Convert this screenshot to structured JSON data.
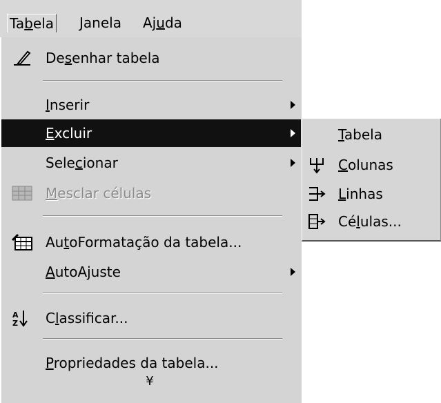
{
  "menubar": {
    "items": [
      {
        "pre": "Ta",
        "key": "b",
        "post": "ela"
      },
      {
        "pre": "",
        "key": "J",
        "post": "anela"
      },
      {
        "pre": "Aj",
        "key": "u",
        "post": "da"
      }
    ]
  },
  "menu": {
    "items": [
      {
        "pre": "De",
        "key": "s",
        "post": "enhar tabela",
        "icon": "pencil-icon"
      },
      {
        "pre": "",
        "key": "I",
        "post": "nserir",
        "submenu": true
      },
      {
        "pre": "",
        "key": "E",
        "post": "xcluir",
        "submenu": true,
        "highlighted": true
      },
      {
        "pre": "Sele",
        "key": "c",
        "post": "ionar",
        "submenu": true
      },
      {
        "pre": "",
        "key": "M",
        "post": "esclar células",
        "icon": "merge-cells-icon",
        "disabled": true
      },
      {
        "pre": "Au",
        "key": "t",
        "post": "oFormatação da tabela...",
        "icon": "table-autoformat-icon"
      },
      {
        "pre": "",
        "key": "A",
        "post": "utoAjuste",
        "submenu": true
      },
      {
        "pre": "C",
        "key": "l",
        "post": "assificar...",
        "icon": "sort-az-icon"
      },
      {
        "pre": "",
        "key": "P",
        "post": "ropriedades da tabela..."
      }
    ],
    "expand_glyph": "¥"
  },
  "submenu": {
    "items": [
      {
        "pre": "",
        "key": "T",
        "post": "abela",
        "icon": ""
      },
      {
        "pre": "",
        "key": "C",
        "post": "olunas",
        "icon": "delete-columns-icon"
      },
      {
        "pre": "",
        "key": "L",
        "post": "inhas",
        "icon": "delete-rows-icon"
      },
      {
        "pre": "Cé",
        "key": "l",
        "post": "ulas...",
        "icon": "delete-cells-icon"
      }
    ]
  }
}
